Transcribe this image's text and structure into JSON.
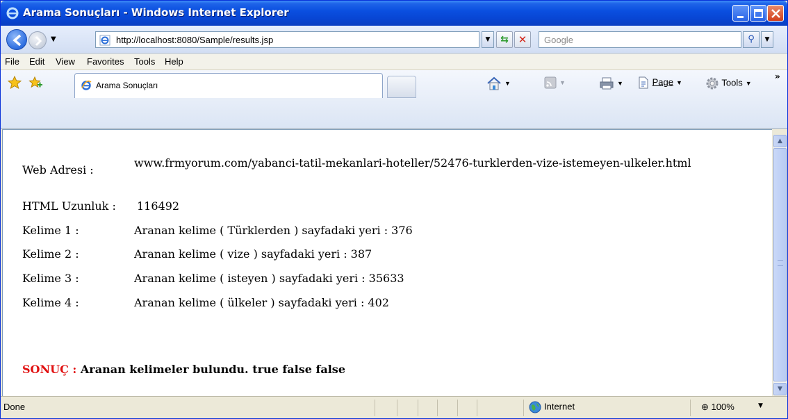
{
  "window": {
    "title": "Arama Sonuçları - Windows Internet Explorer"
  },
  "nav": {
    "address": "http://localhost:8080/Sample/results.jsp",
    "search_placeholder": "Google"
  },
  "menu": {
    "items": [
      {
        "label": "File"
      },
      {
        "label": "Edit"
      },
      {
        "label": "View"
      },
      {
        "label": "Favorites"
      },
      {
        "label": "Tools"
      },
      {
        "label": "Help"
      }
    ]
  },
  "tabs": {
    "active_label": "Arama Sonuçları"
  },
  "commands": {
    "page": "Page",
    "tools": "Tools"
  },
  "content": {
    "web_label": "Web Adresi :",
    "web_value": "www.frmyorum.com/yabanci-tatil-mekanlari-hoteller/52476-turklerden-vize-istemeyen-ulkeler.html",
    "html_label": "HTML Uzunluk :",
    "html_value": "116492",
    "words": [
      {
        "label": "Kelime 1 :",
        "value": "Aranan kelime ( Türklerden ) sayfadaki yeri : 376"
      },
      {
        "label": "Kelime 2 :",
        "value": "Aranan kelime ( vize ) sayfadaki yeri : 387"
      },
      {
        "label": "Kelime 3 :",
        "value": "Aranan kelime ( isteyen ) sayfadaki yeri : 35633"
      },
      {
        "label": "Kelime 4 :",
        "value": "Aranan kelime ( ülkeler ) sayfadaki yeri : 402"
      }
    ],
    "result_label": "SONUÇ :",
    "result_text": "Aranan kelimeler bulundu. true false false"
  },
  "status": {
    "text": "Done",
    "zone": "Internet",
    "zoom": "100%"
  },
  "colors": {
    "titlebar": "#0a4fe0",
    "result_label": "#e01010"
  }
}
